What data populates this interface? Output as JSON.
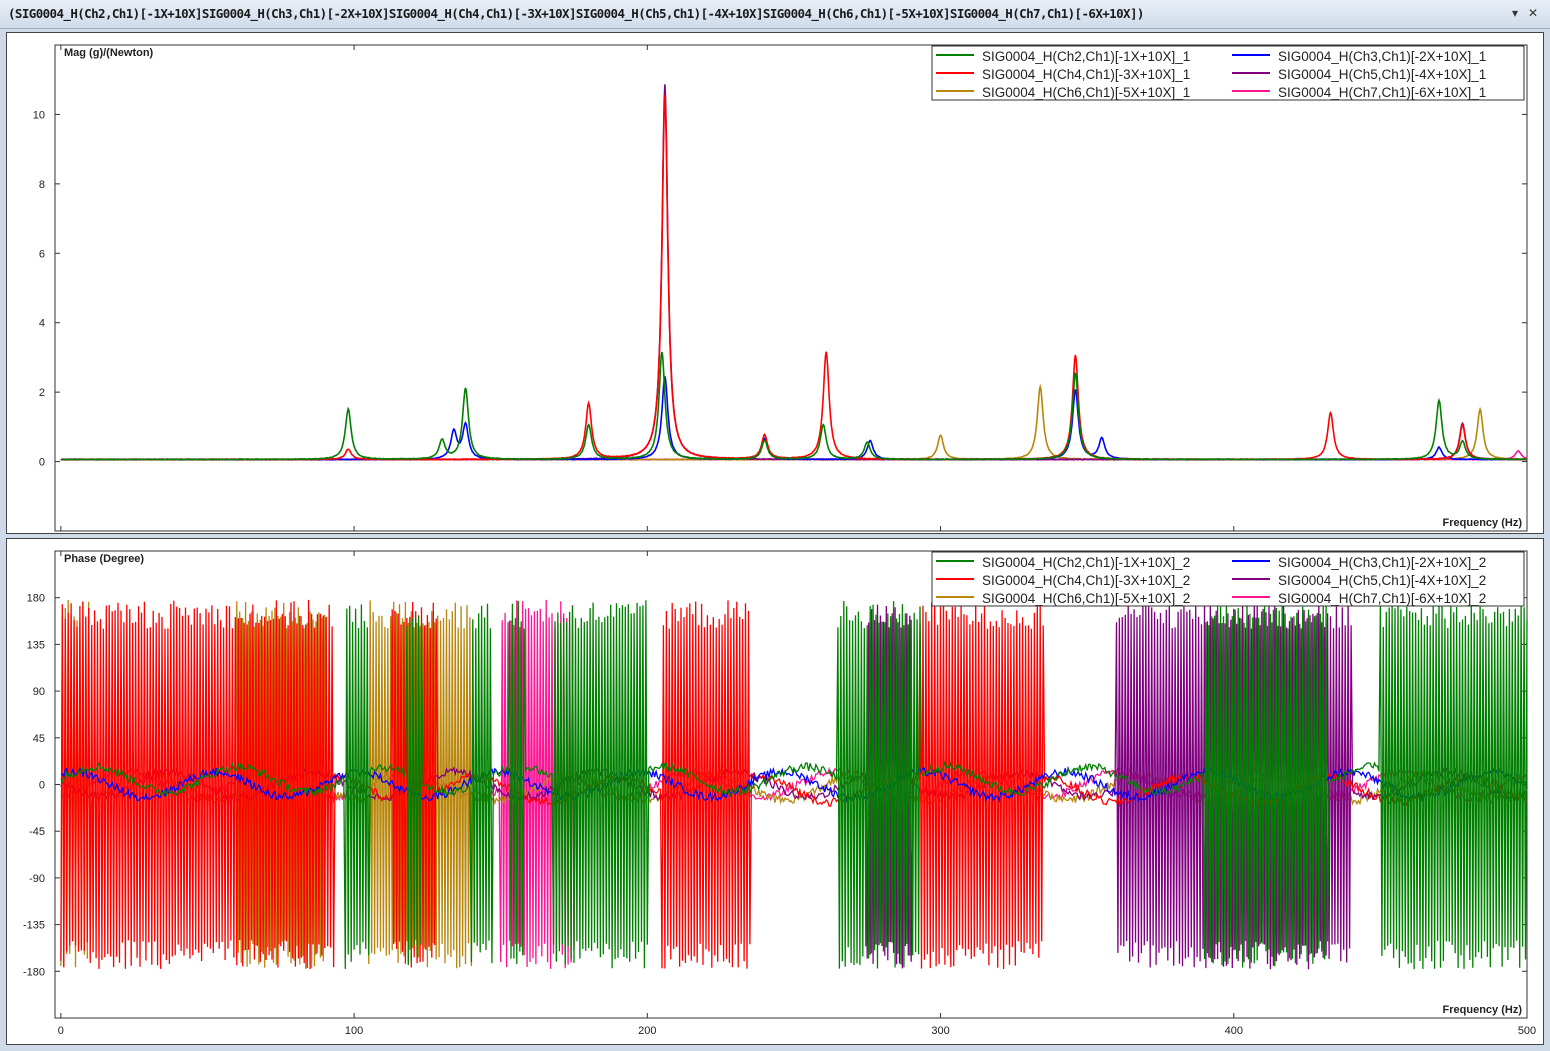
{
  "window": {
    "title": "(SIG0004_H(Ch2,Ch1)[-1X+10X]SIG0004_H(Ch3,Ch1)[-2X+10X]SIG0004_H(Ch4,Ch1)[-3X+10X]SIG0004_H(Ch5,Ch1)[-4X+10X]SIG0004_H(Ch6,Ch1)[-5X+10X]SIG0004_H(Ch7,Ch1)[-6X+10X])",
    "dropdown_icon": "chevron-down-icon",
    "close_icon": "close-icon"
  },
  "chart_data": [
    {
      "type": "line",
      "ylabel": "Mag (g)/(Newton)",
      "xlabel": "Frequency (Hz)",
      "xlim": [
        -2,
        500
      ],
      "ylim": [
        -2.0,
        12.0
      ],
      "yticks": [
        0,
        2,
        4,
        6,
        8,
        10
      ],
      "grid": false,
      "legend_position": "top-right",
      "series": [
        {
          "name": "SIG0004_H(Ch2,Ch1)[-1X+10X]_1",
          "color": "#008000",
          "peaks": [
            [
              98,
              1.45
            ],
            [
              130,
              0.55
            ],
            [
              138,
              2.05
            ],
            [
              180,
              1.0
            ],
            [
              205,
              3.1
            ],
            [
              240,
              0.55
            ],
            [
              260,
              1.0
            ],
            [
              275,
              0.5
            ],
            [
              346,
              2.5
            ],
            [
              470,
              1.7
            ],
            [
              478,
              0.5
            ]
          ]
        },
        {
          "name": "SIG0004_H(Ch3,Ch1)[-2X+10X]_1",
          "color": "#0000ff",
          "peaks": [
            [
              134,
              0.8
            ],
            [
              138,
              1.0
            ],
            [
              206,
              2.4
            ],
            [
              240,
              0.6
            ],
            [
              276,
              0.55
            ],
            [
              346,
              2.0
            ],
            [
              355,
              0.6
            ],
            [
              470,
              0.35
            ]
          ]
        },
        {
          "name": "SIG0004_H(Ch4,Ch1)[-3X+10X]_1",
          "color": "#ff0000",
          "peaks": [
            [
              98,
              0.3
            ],
            [
              180,
              1.6
            ],
            [
              206,
              10.5
            ],
            [
              240,
              0.7
            ],
            [
              261,
              3.1
            ],
            [
              346,
              3.0
            ],
            [
              433,
              1.35
            ],
            [
              478,
              1.0
            ]
          ]
        },
        {
          "name": "SIG0004_H(Ch5,Ch1)[-4X+10X]_1",
          "color": "#800080",
          "peaks": [
            [
              206,
              10.8
            ],
            [
              478,
              1.05
            ]
          ]
        },
        {
          "name": "SIG0004_H(Ch6,Ch1)[-5X+10X]_1",
          "color": "#b8860b",
          "peaks": [
            [
              300,
              0.7
            ],
            [
              334,
              2.1
            ],
            [
              484,
              1.45
            ]
          ]
        },
        {
          "name": "SIG0004_H(Ch7,Ch1)[-6X+10X]_1",
          "color": "#ff1493",
          "peaks": [
            [
              497,
              0.25
            ]
          ]
        }
      ]
    },
    {
      "type": "line",
      "ylabel": "Phase (Degree)",
      "xlabel": "Frequency (Hz)",
      "xlim": [
        -2,
        500
      ],
      "ylim": [
        -225,
        225
      ],
      "yticks": [
        180,
        135,
        90,
        45,
        0,
        -45,
        -90,
        -135,
        -180
      ],
      "xticks": [
        0,
        100,
        200,
        300,
        400,
        500
      ],
      "grid": false,
      "legend_position": "top-right",
      "series": [
        {
          "name": "SIG0004_H(Ch2,Ch1)[-1X+10X]_2",
          "color": "#008000",
          "wrap_ranges": [
            [
              97,
              105
            ],
            [
              118,
              123
            ],
            [
              140,
              147
            ],
            [
              153,
              158
            ],
            [
              168,
              200
            ],
            [
              265,
              293
            ],
            [
              390,
              432
            ],
            [
              450,
              500
            ]
          ]
        },
        {
          "name": "SIG0004_H(Ch3,Ch1)[-2X+10X]_2",
          "color": "#0000ff",
          "wrap_ranges": []
        },
        {
          "name": "SIG0004_H(Ch4,Ch1)[-3X+10X]_2",
          "color": "#ff0000",
          "wrap_ranges": [
            [
              0,
              93
            ],
            [
              113,
              128
            ],
            [
              205,
              235
            ],
            [
              293,
              335
            ]
          ]
        },
        {
          "name": "SIG0004_H(Ch5,Ch1)[-4X+10X]_2",
          "color": "#800080",
          "wrap_ranges": [
            [
              275,
              290
            ],
            [
              360,
              440
            ]
          ]
        },
        {
          "name": "SIG0004_H(Ch6,Ch1)[-5X+10X]_2",
          "color": "#b8860b",
          "wrap_ranges": [
            [
              0,
              10
            ],
            [
              60,
              90
            ],
            [
              105,
              140
            ]
          ]
        },
        {
          "name": "SIG0004_H(Ch7,Ch1)[-6X+10X]_2",
          "color": "#ff1493",
          "wrap_ranges": [
            [
              150,
              175
            ]
          ]
        }
      ]
    }
  ]
}
